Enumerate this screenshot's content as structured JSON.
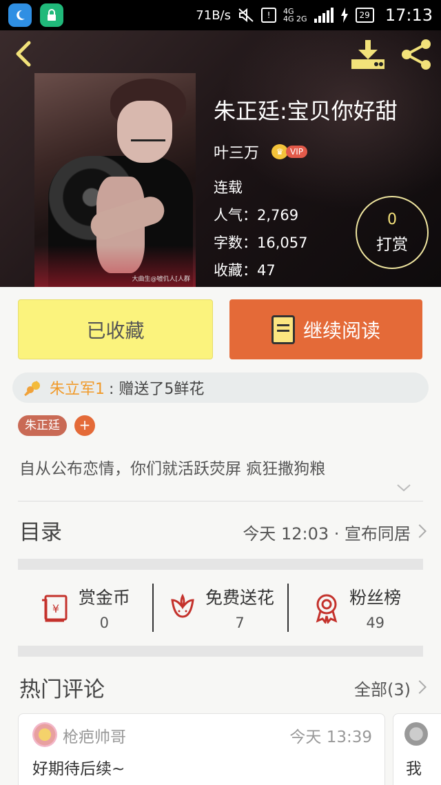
{
  "status_bar": {
    "speed": "71B/s",
    "network": "4G",
    "network2": "4G 2G",
    "battery": "29",
    "time": "17:13"
  },
  "book": {
    "title": "朱正廷:宝贝你好甜",
    "author": "叶三万",
    "vip_label": "VIP",
    "status": "连载",
    "popularity_label": "人气：",
    "popularity": "2,769",
    "word_count_label": "字数：",
    "word_count": "16,057",
    "favorites_label": "收藏：",
    "favorites": "47",
    "cover_watermark": "大曲生@嘘仉人[人群"
  },
  "tip": {
    "count": "0",
    "label": "打赏"
  },
  "actions": {
    "favorited_label": "已收藏",
    "continue_label": "继续阅读"
  },
  "gift": {
    "user": "朱立军1",
    "message": ": 赠送了5鲜花"
  },
  "tags": {
    "items": [
      "朱正廷"
    ],
    "add": "+"
  },
  "description": "自从公布恋情，你们就活跃荧屏 疯狂撒狗粮",
  "catalog": {
    "title": "目录",
    "latest": "今天 12:03 · 宣布同居"
  },
  "stats": [
    {
      "label": "赏金币",
      "value": "0",
      "icon": "red-envelope-icon"
    },
    {
      "label": "免费送花",
      "value": "7",
      "icon": "flower-icon"
    },
    {
      "label": "粉丝榜",
      "value": "49",
      "icon": "award-ribbon-icon"
    }
  ],
  "comments": {
    "title": "热门评论",
    "all_label": "全部(3)",
    "items": [
      {
        "user": "枪疤帅哥",
        "time": "今天 13:39",
        "text": "好期待后续~"
      },
      {
        "user": "",
        "time": "",
        "text": "我"
      }
    ]
  },
  "colors": {
    "accent_orange": "#e46a38",
    "fav_yellow": "#fbf37d",
    "gift_user": "#f09a2a",
    "tag_bg": "#c96a55",
    "stat_icon_red": "#c4322c"
  }
}
